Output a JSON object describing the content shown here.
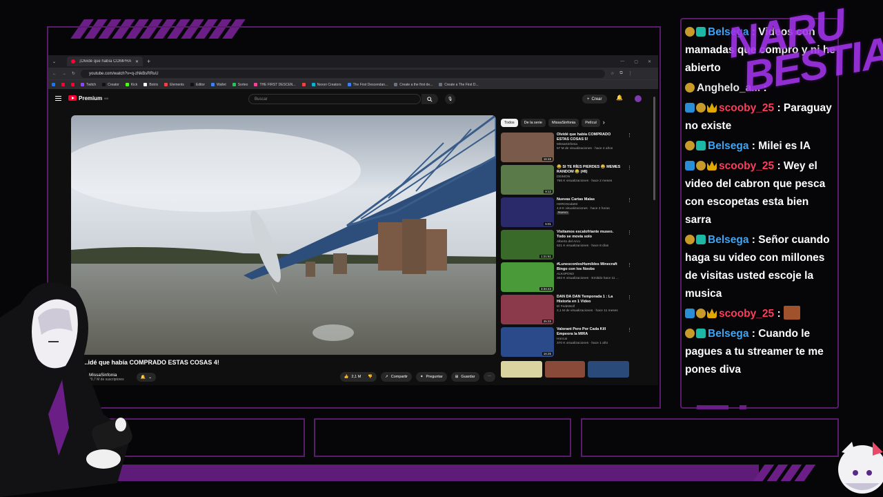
{
  "browser": {
    "tab_title": "¡Olvidé que había COMPRADO",
    "url": "youtube.com/watch?v=q-zNkBsRRuU",
    "bookmarks": [
      {
        "label": "",
        "color": "#1877f2"
      },
      {
        "label": "",
        "color": "#ff0033"
      },
      {
        "label": "",
        "color": "#ff0033"
      },
      {
        "label": "Twitch",
        "color": "#9146ff"
      },
      {
        "label": "Creator",
        "color": "#111111"
      },
      {
        "label": "Kick",
        "color": "#53fc18"
      },
      {
        "label": "Botrix",
        "color": "#ffffff"
      },
      {
        "label": "Elements",
        "color": "#e44"
      },
      {
        "label": "Editor",
        "color": "#111111"
      },
      {
        "label": "Wallet",
        "color": "#3b82f6"
      },
      {
        "label": "Sorteo",
        "color": "#22c55e"
      },
      {
        "label": "THE FIRST DESCEN...",
        "color": "#ec4899"
      },
      {
        "label": "",
        "color": "#ef4444"
      },
      {
        "label": "Nexon Creators",
        "color": "#06b6d4"
      },
      {
        "label": "The First Descendan...",
        "color": "#3b82f6"
      },
      {
        "label": "Create a the first de...",
        "color": "#6b7280"
      },
      {
        "label": "Create a The First D...",
        "color": "#6b7280"
      }
    ]
  },
  "youtube": {
    "logo_text": "Premium",
    "logo_sup": "MX",
    "search_placeholder": "Buscar",
    "create_label": "Crear",
    "video_title": "...idé que había COMPRADO ESTAS COSAS 4!",
    "channel_name": "MissaSinfonia",
    "subscribers": "20,7 M de suscriptores",
    "likes": "2,1 M",
    "share_label": "Compartir",
    "ask_label": "Preguntar",
    "save_label": "Guardar",
    "chips": [
      "Todos",
      "De la serie",
      "MissaSinfonia",
      "Películ"
    ],
    "recommendations": [
      {
        "title": "Olvidé que había COMPRADO ESTAS COSAS 5!",
        "channel": "MissaSinfonia",
        "meta": "57 M de visualizaciones · hace 4 años",
        "duration": "18:48",
        "color": "#7a5a4a"
      },
      {
        "title": "😂 SI TE RÍES PIERDES 😂 MEMES RANDOM 😂 (#8)",
        "channel": "DEIMON",
        "meta": "766 K visualizaciones · hace 2 meses",
        "duration": "9:12",
        "color": "#5a7a4a"
      },
      {
        "title": "Nuevas Cartas Malas",
        "channel": "HEROSoda92",
        "meta": "4,9 K visualizaciones · hace 2 horas",
        "duration": "6:01",
        "color": "#2a2a6a",
        "badge": "Nuevo"
      },
      {
        "title": "Visitamos escalofriante museo. Todo se movía solo",
        "channel": "Alberto del Arco",
        "meta": "621 K visualizaciones · hace 8 días",
        "duration": "1:21:51",
        "color": "#3a6a2a"
      },
      {
        "title": "#LunesconlosHumildes Minecraft Bingo con los Noobs",
        "channel": "ALK4PON3",
        "meta": "302 K visualizaciones · Emitido hace 11 ...",
        "duration": "3:34:43",
        "color": "#4a9a3a"
      },
      {
        "title": "DAN DA DAN Temporada 1 : La Historia en 1 Video",
        "channel": "El FedeWolf",
        "meta": "2,1 M de visualizaciones · hace 11 meses",
        "duration": "25:33",
        "color": "#8a3a4a"
      },
      {
        "title": "Valorant Pero Por Cada Kill Empeora la MIRA",
        "channel": "Horcus",
        "meta": "370 K visualizaciones · hace 1 año",
        "duration": "16:25",
        "color": "#2a4a8a"
      }
    ]
  },
  "chat": [
    {
      "user": "Belsega",
      "color": "#3da5f5",
      "badges": [
        "b-mod",
        "b-sub"
      ],
      "text": "Videos con mamadas que compro y ni he abierto"
    },
    {
      "user": "Anghelo_a...",
      "color": "#e8e8e8",
      "badges": [
        "b-mod"
      ],
      "text": ""
    },
    {
      "user": "scooby_25",
      "color": "#ff3d5a",
      "badges": [
        "b-vip",
        "b-mod",
        "b-crown"
      ],
      "text": "Paraguay no existe"
    },
    {
      "user": "Belsega",
      "color": "#3da5f5",
      "badges": [
        "b-mod",
        "b-sub"
      ],
      "text": "Milei es IA"
    },
    {
      "user": "scooby_25",
      "color": "#ff3d5a",
      "badges": [
        "b-vip",
        "b-mod",
        "b-crown"
      ],
      "text": "Wey el video del cabron que pesca con escopetas esta bien sarra"
    },
    {
      "user": "Belsega",
      "color": "#3da5f5",
      "badges": [
        "b-mod",
        "b-sub"
      ],
      "text": "Señor cuando haga su video con millones de visitas usted escoje la musica"
    },
    {
      "user": "scooby_25",
      "color": "#ff3d5a",
      "badges": [
        "b-vip",
        "b-mod",
        "b-crown"
      ],
      "text": ""
    },
    {
      "user": "Belsega",
      "color": "#3da5f5",
      "badges": [
        "b-mod",
        "b-sub"
      ],
      "text": "Cuando le pagues a tu streamer te me pones diva"
    }
  ],
  "brand": {
    "line1": "NARU",
    "line2": "BESTIA"
  },
  "colors": {
    "accent": "#6b1f86",
    "frame": "#5a1d6e",
    "yt_red": "#ff0033"
  }
}
